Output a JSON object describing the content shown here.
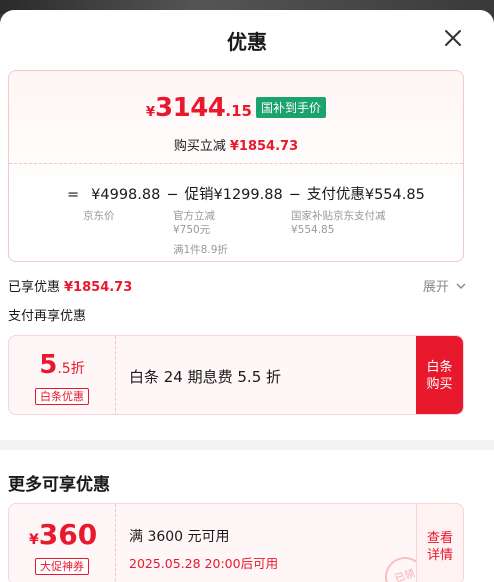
{
  "header": {
    "title": "优惠"
  },
  "summary": {
    "price_yen": "¥",
    "price_int": "3144",
    "price_dec": ".15",
    "badge": "国补到手价",
    "reduce_label": "购买立减",
    "reduce_value": "¥1854.73",
    "formula": {
      "eq": "=",
      "jd_price": "¥4998.88",
      "minus1": "−",
      "promo": "促销¥1299.88",
      "minus2": "−",
      "pay": "支付优惠¥554.85"
    },
    "subs": {
      "jd_label": "京东价",
      "promo_l1": "官方立减",
      "promo_l2": "¥750元",
      "promo_l3": "满1件8.9折",
      "pay_l1": "国家补贴京东支付减",
      "pay_l2": "¥554.85"
    }
  },
  "enjoyed": {
    "label": "已享优惠",
    "value": "¥1854.73",
    "expand": "展开"
  },
  "pay_section": {
    "title": "支付再享优惠"
  },
  "baitiao": {
    "discount_big": "5",
    "discount_small": ".5折",
    "tag": "白条优惠",
    "text": "白条 24 期息费 5.5 折",
    "button_l1": "白条",
    "button_l2": "购买"
  },
  "more": {
    "title": "更多可享优惠"
  },
  "coupon": {
    "yen": "¥",
    "amount": "360",
    "tag": "大促神券",
    "text": "满 3600 元可用",
    "time": "2025.05.28 20:00后可用",
    "button_l1": "查看",
    "button_l2": "详情",
    "stamp": "已领"
  },
  "colors": {
    "accent": "#e8192c",
    "green_badge": "#1aa36b"
  },
  "icons": {
    "close": "close-icon",
    "expand": "chevron-down-icon"
  }
}
